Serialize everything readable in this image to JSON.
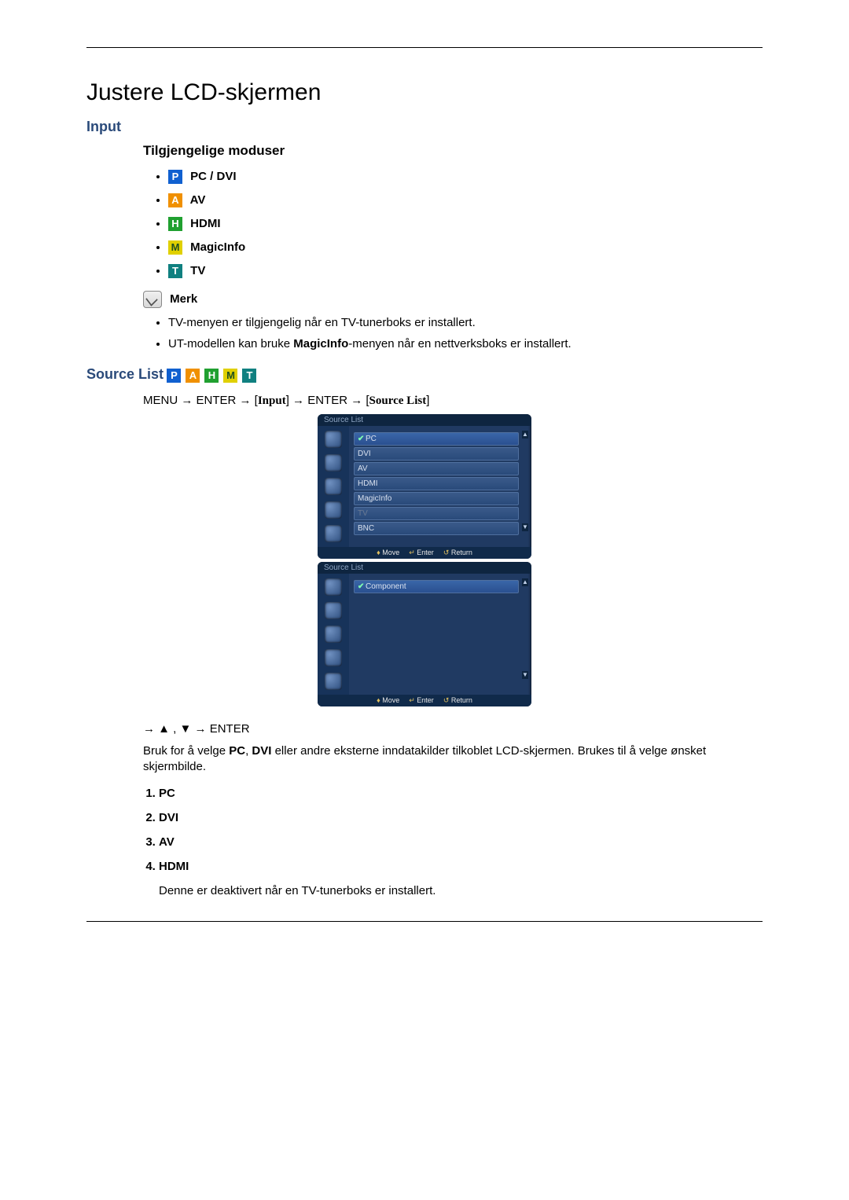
{
  "page_title": "Justere LCD-skjermen",
  "section_input": "Input",
  "modes_heading": "Tilgjengelige moduser",
  "mode_badges": {
    "P": {
      "letter": "P",
      "bg": "#1060d0",
      "label": "PC / DVI"
    },
    "A": {
      "letter": "A",
      "bg": "#f09000",
      "label": "AV"
    },
    "H": {
      "letter": "H",
      "bg": "#20a030",
      "label": "HDMI"
    },
    "M": {
      "letter": "M",
      "bg": "#e0d000",
      "label": "MagicInfo"
    },
    "T": {
      "letter": "T",
      "bg": "#108080",
      "label": "TV"
    }
  },
  "note_label": "Merk",
  "note_items": [
    "TV-menyen er tilgjengelig når en TV-tunerboks er installert.",
    {
      "pre": "UT-modellen kan bruke ",
      "bold": "MagicInfo",
      "post": "-menyen når en nettverksboks er installert."
    }
  ],
  "source_list_heading": "Source List",
  "breadcrumb": {
    "p1": "MENU → ENTER → [",
    "w1": "Input",
    "p2": "] → ENTER → [",
    "w2": "Source List",
    "p3": "]"
  },
  "osd1": {
    "title": "Source List",
    "items": [
      {
        "label": "PC",
        "selected": true
      },
      {
        "label": "DVI"
      },
      {
        "label": "AV"
      },
      {
        "label": "HDMI"
      },
      {
        "label": "MagicInfo"
      },
      {
        "label": "TV",
        "disabled": true
      },
      {
        "label": "BNC"
      }
    ],
    "footer": {
      "move": "Move",
      "enter": "Enter",
      "return": "Return"
    }
  },
  "osd2": {
    "title": "Source List",
    "items": [
      {
        "label": "Component",
        "selected": true
      }
    ],
    "footer": {
      "move": "Move",
      "enter": "Enter",
      "return": "Return"
    }
  },
  "post_nav": "→ ▲ , ▼ → ENTER",
  "usage_para": {
    "p1": "Bruk for å velge ",
    "b1": "PC",
    "p2": ", ",
    "b2": "DVI",
    "p3": " eller andre eksterne inndatakilder tilkoblet LCD-skjermen. Brukes til å velge ønsket skjermbilde."
  },
  "num_list": [
    "PC",
    "DVI",
    "AV",
    "HDMI"
  ],
  "hdmi_note": "Denne er deaktivert når en TV-tunerboks er installert."
}
